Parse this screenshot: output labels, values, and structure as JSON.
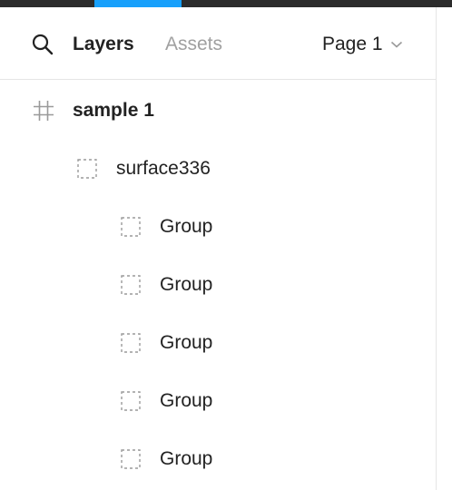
{
  "colors": {
    "topbar": "#2c2c2c",
    "active_tab_indicator": "#18a0fb",
    "text_primary": "#222222",
    "text_inactive": "#a0a0a0",
    "divider": "#e5e5e5",
    "icon": "#9a9a9a"
  },
  "header": {
    "search_icon": "search-icon",
    "tabs": [
      {
        "label": "Layers",
        "active": true
      },
      {
        "label": "Assets",
        "active": false
      }
    ],
    "page_selector": {
      "label": "Page 1",
      "icon": "chevron-down-icon"
    }
  },
  "layers": [
    {
      "name": "sample 1",
      "type": "frame",
      "icon": "frame-hash-icon",
      "depth": 0
    },
    {
      "name": "surface336",
      "type": "group",
      "icon": "group-dashed-icon",
      "depth": 1
    },
    {
      "name": "Group",
      "type": "group",
      "icon": "group-dashed-icon",
      "depth": 2
    },
    {
      "name": "Group",
      "type": "group",
      "icon": "group-dashed-icon",
      "depth": 2
    },
    {
      "name": "Group",
      "type": "group",
      "icon": "group-dashed-icon",
      "depth": 2
    },
    {
      "name": "Group",
      "type": "group",
      "icon": "group-dashed-icon",
      "depth": 2
    },
    {
      "name": "Group",
      "type": "group",
      "icon": "group-dashed-icon",
      "depth": 2
    }
  ]
}
